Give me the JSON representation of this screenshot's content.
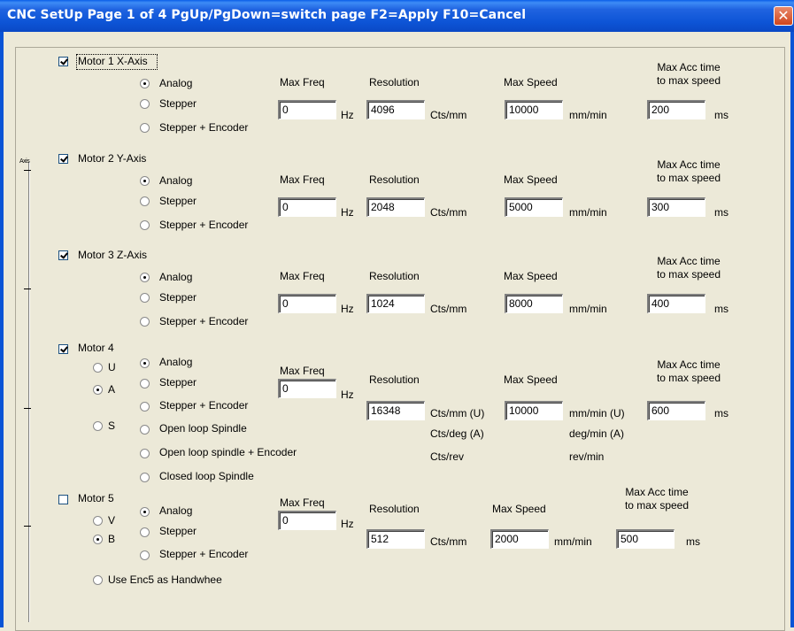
{
  "window": {
    "title": "CNC SetUp Page 1 of 4   PgUp/PgDown=switch page   F2=Apply   F10=Cancel",
    "close_glyph": "✕"
  },
  "common": {
    "analog": "Analog",
    "stepper": "Stepper",
    "stepper_encoder": "Stepper + Encoder",
    "max_freq": "Max Freq",
    "hz": "Hz",
    "resolution": "Resolution",
    "cts_mm": "Cts/mm",
    "max_speed": "Max Speed",
    "mm_min": "mm/min",
    "max_acc_line1": "Max Acc time",
    "max_acc_line2": "to max speed",
    "ms": "ms"
  },
  "motors": [
    {
      "label": "Motor 1 X-Axis",
      "checked": true,
      "mode": "Analog",
      "max_freq": "0",
      "resolution": "4096",
      "max_speed": "10000",
      "max_acc": "200"
    },
    {
      "label": "Motor 2 Y-Axis",
      "checked": true,
      "mode": "Analog",
      "max_freq": "0",
      "resolution": "2048",
      "max_speed": "5000",
      "max_acc": "300"
    },
    {
      "label": "Motor 3 Z-Axis",
      "checked": true,
      "mode": "Analog",
      "max_freq": "0",
      "resolution": "1024",
      "max_speed": "8000",
      "max_acc": "400"
    },
    {
      "label": "Motor 4",
      "checked": true,
      "mode": "Analog",
      "axis_options": [
        "U",
        "A",
        "S"
      ],
      "axis_selected": "A",
      "extra_modes": [
        "Open loop Spindle",
        "Open loop spindle + Encoder",
        "Closed loop Spindle"
      ],
      "max_freq": "0",
      "resolution": "16348",
      "max_speed": "10000",
      "max_acc": "600",
      "res_units": [
        "Cts/mm (U)",
        "Cts/deg (A)",
        "Cts/rev"
      ],
      "speed_units": [
        "mm/min (U)",
        "deg/min (A)",
        "rev/min"
      ]
    },
    {
      "label": "Motor 5",
      "checked": false,
      "mode": "Analog",
      "axis_options": [
        "V",
        "B"
      ],
      "axis_selected": "B",
      "max_freq": "0",
      "resolution": "512",
      "max_speed": "2000",
      "max_acc": "500",
      "handwheel_label": "Use Enc5 as Handwhee"
    }
  ],
  "slider": {
    "label": "Axis"
  }
}
